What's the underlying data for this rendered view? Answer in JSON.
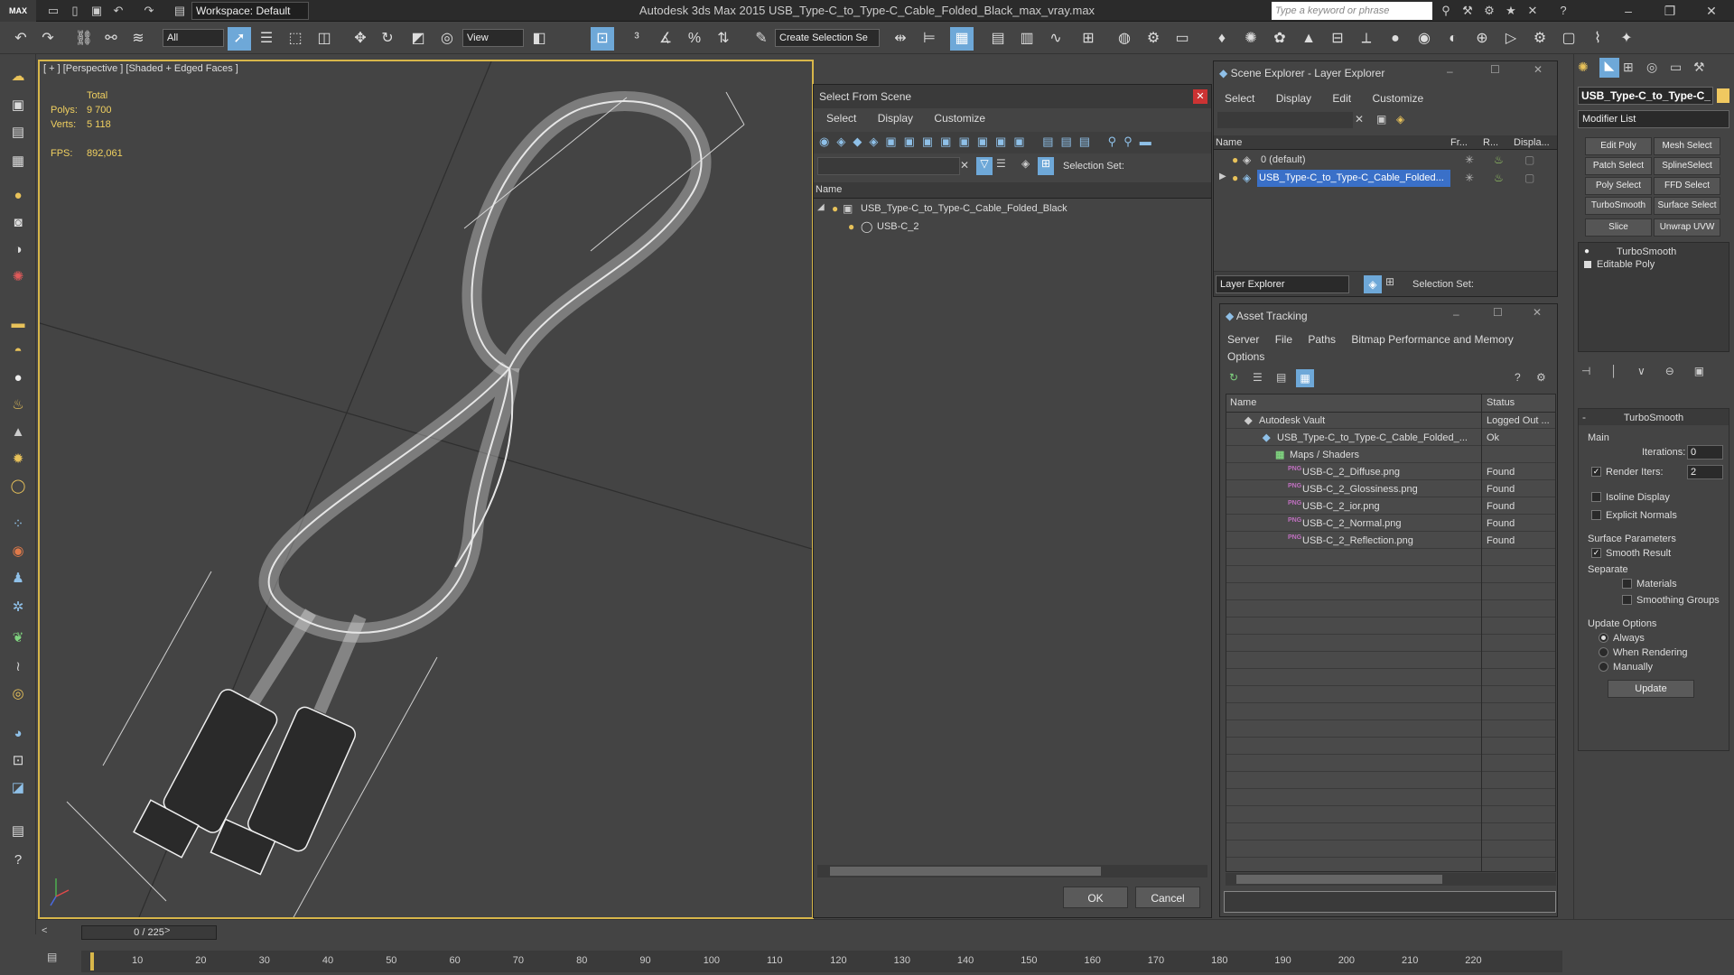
{
  "app": {
    "logo": "MAX",
    "title": "Autodesk 3ds Max  2015     USB_Type-C_to_Type-C_Cable_Folded_Black_max_vray.max",
    "workspace": "Workspace: Default",
    "search_placeholder": "Type a keyword or phrase"
  },
  "toolbar": {
    "selection_filter": "All",
    "ref_coord": "View",
    "create_selection_set": "Create Selection Se"
  },
  "viewport": {
    "label": "[ + ] [Perspective ] [Shaded + Edged Faces ]",
    "stats_total": "Total",
    "polys_label": "Polys:",
    "polys_value": "9 700",
    "verts_label": "Verts:",
    "verts_value": "5 118",
    "fps_label": "FPS:",
    "fps_value": "892,061"
  },
  "select_from_scene": {
    "title": "Select From Scene",
    "menu": [
      "Select",
      "Display",
      "Customize"
    ],
    "selection_set_label": "Selection Set:",
    "column_name": "Name",
    "tree": [
      {
        "label": "USB_Type-C_to_Type-C_Cable_Folded_Black"
      },
      {
        "label": "USB-C_2"
      }
    ],
    "ok": "OK",
    "cancel": "Cancel"
  },
  "scene_explorer": {
    "title": "Scene Explorer - Layer Explorer",
    "menu": [
      "Select",
      "Display",
      "Edit",
      "Customize"
    ],
    "columns": [
      "Name",
      "Fr...",
      "R...",
      "Displa..."
    ],
    "rows": [
      {
        "label": "0 (default)"
      },
      {
        "label": "USB_Type-C_to_Type-C_Cable_Folded..."
      }
    ],
    "footer_dropdown": "Layer Explorer",
    "selection_set_label": "Selection Set:"
  },
  "asset_tracking": {
    "title": "Asset Tracking",
    "menu": [
      "Server",
      "File",
      "Paths",
      "Bitmap Performance and Memory",
      "Options"
    ],
    "columns": [
      "Name",
      "Status"
    ],
    "rows": [
      {
        "name": "Autodesk Vault",
        "status": "Logged Out ..."
      },
      {
        "name": "USB_Type-C_to_Type-C_Cable_Folded_...",
        "status": "Ok"
      },
      {
        "name": "Maps / Shaders",
        "status": ""
      },
      {
        "name": "USB-C_2_Diffuse.png",
        "status": "Found"
      },
      {
        "name": "USB-C_2_Glossiness.png",
        "status": "Found"
      },
      {
        "name": "USB-C_2_ior.png",
        "status": "Found"
      },
      {
        "name": "USB-C_2_Normal.png",
        "status": "Found"
      },
      {
        "name": "USB-C_2_Reflection.png",
        "status": "Found"
      }
    ]
  },
  "command_panel": {
    "object_name": "USB_Type-C_to_Type-C_",
    "modifier_list": "Modifier List",
    "modifier_buttons": [
      [
        "Edit Poly",
        "Mesh Select"
      ],
      [
        "Patch Select",
        "SplineSelect"
      ],
      [
        "Poly Select",
        "FFD Select"
      ],
      [
        "TurboSmooth",
        "Surface Select"
      ],
      [
        "Slice",
        "Unwrap UVW"
      ]
    ],
    "stack": [
      "TurboSmooth",
      "Editable Poly"
    ],
    "rollout_title": "TurboSmooth",
    "main_label": "Main",
    "iterations_label": "Iterations:",
    "iterations_value": "0",
    "render_iters_label": "Render Iters:",
    "render_iters_value": "2",
    "isoline_label": "Isoline Display",
    "explicit_normals_label": "Explicit Normals",
    "surface_params_label": "Surface Parameters",
    "smooth_result_label": "Smooth Result",
    "separate_label": "Separate",
    "materials_label": "Materials",
    "smoothing_groups_label": "Smoothing Groups",
    "update_options_label": "Update Options",
    "always_label": "Always",
    "when_rendering_label": "When Rendering",
    "manually_label": "Manually",
    "update_button": "Update"
  },
  "timeline": {
    "frame": "0 / 225",
    "ticks": [
      "10",
      "20",
      "30",
      "40",
      "50",
      "60",
      "70",
      "80",
      "90",
      "100",
      "110",
      "120",
      "130",
      "140",
      "150",
      "160",
      "170",
      "180",
      "190",
      "200",
      "210",
      "220"
    ]
  }
}
